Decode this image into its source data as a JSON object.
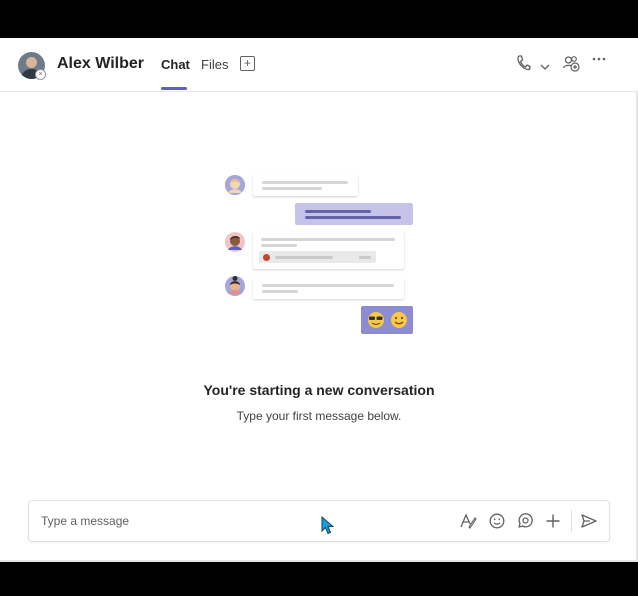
{
  "header": {
    "contact_name": "Alex Wilber",
    "tabs": [
      {
        "label": "Chat",
        "active": true
      },
      {
        "label": "Files",
        "active": false
      }
    ],
    "icons": [
      "add-tab-icon",
      "call-icon",
      "chevron-down-icon",
      "add-people-icon",
      "more-options-icon"
    ]
  },
  "empty_state": {
    "title": "You're starting a new conversation",
    "subtitle": "Type your first message below."
  },
  "compose": {
    "placeholder": "Type a message",
    "icons": [
      "format-icon",
      "emoji-icon",
      "loop-icon",
      "attach-plus-icon",
      "send-icon"
    ]
  },
  "colors": {
    "accent": "#5b5fc7",
    "bubble_me": "#c5c3e8",
    "emoji_box": "#8e8cd0"
  }
}
